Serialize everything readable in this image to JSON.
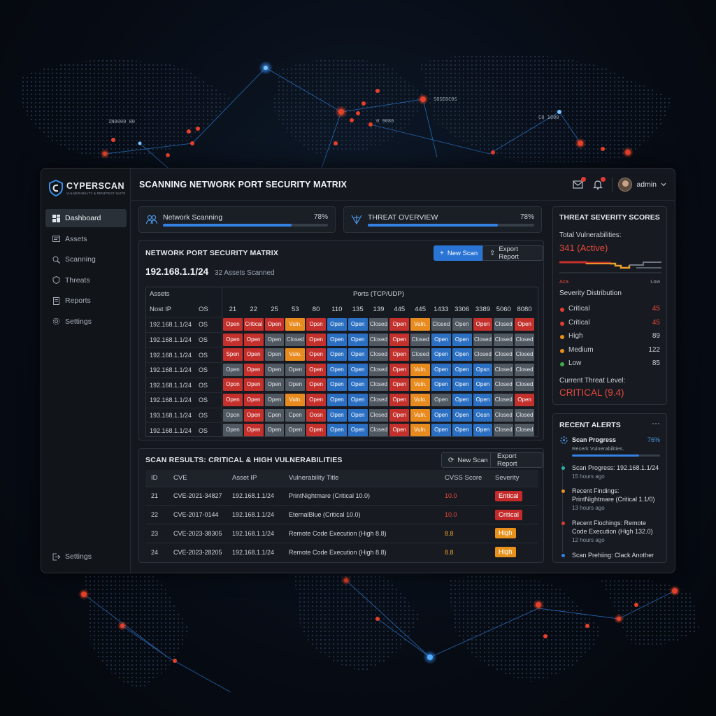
{
  "map": {
    "labels": [
      "IN0000 80",
      "SOSE0C0S",
      "0 9080",
      "C0 1000"
    ]
  },
  "brand": {
    "name": "CYPERSCAN",
    "tagline": "VULNERABILITY & PENETEST SUITE"
  },
  "header": {
    "title": "SCANNING NETWORK PORT SECURITY MATRIX",
    "user": "admin"
  },
  "sidebar": {
    "items": [
      {
        "label": "Dashboard",
        "icon": "dashboard-icon",
        "active": true
      },
      {
        "label": "Assets",
        "icon": "assets-icon",
        "active": false
      },
      {
        "label": "Scanning",
        "icon": "scanning-icon",
        "active": false
      },
      {
        "label": "Threats",
        "icon": "shield-icon",
        "active": false
      },
      {
        "label": "Reports",
        "icon": "reports-icon",
        "active": false
      },
      {
        "label": "Settings",
        "icon": "gear-icon",
        "active": false
      }
    ],
    "bottom": {
      "label": "Settings",
      "icon": "logout-icon"
    }
  },
  "progress": [
    {
      "label": "Network Scanning",
      "value_text": "78%",
      "value": 0.78
    },
    {
      "label": "THREAT OVERVIEW",
      "value_text": "78%",
      "value": 0.78
    }
  ],
  "matrix": {
    "title": "NETWORK PORT SECURITY MATRIX",
    "new_scan": "New Scan",
    "export": "Export Report",
    "subnet": "192.168.1.1/24",
    "asset_count": "32 Assets Scanned",
    "group_assets": "Assets",
    "group_ports": "Ports (TCP/UDP)",
    "col_ip": "Nost IP",
    "col_os": "OS",
    "ports": [
      "21",
      "22",
      "25",
      "53",
      "80",
      "110",
      "135",
      "139",
      "445",
      "445",
      "1433",
      "3306",
      "3389",
      "5060",
      "8080"
    ],
    "rows": [
      {
        "ip": "192.168.1.1/24",
        "os": "OS",
        "cells": [
          [
            "Open",
            "r"
          ],
          [
            "Critical",
            "r"
          ],
          [
            "Open",
            "r"
          ],
          [
            "Vuln.",
            "o"
          ],
          [
            "Opsn",
            "r"
          ],
          [
            "Open",
            "b"
          ],
          [
            "Open",
            "b"
          ],
          [
            "Closed",
            "g"
          ],
          [
            "Open",
            "r"
          ],
          [
            "Vuln.",
            "o"
          ],
          [
            "Closed",
            "g"
          ],
          [
            "Open",
            "g"
          ],
          [
            "Open",
            "r"
          ],
          [
            "Closed",
            "g"
          ],
          [
            "Open",
            "r"
          ]
        ]
      },
      {
        "ip": "192.168.1.1/24",
        "os": "OS",
        "cells": [
          [
            "Open",
            "r"
          ],
          [
            "Open",
            "r"
          ],
          [
            "Open",
            "g"
          ],
          [
            "Closed",
            "g"
          ],
          [
            "Open",
            "r"
          ],
          [
            "Open",
            "b"
          ],
          [
            "Open",
            "b"
          ],
          [
            "Closed",
            "g"
          ],
          [
            "Open",
            "r"
          ],
          [
            "Closed",
            "g"
          ],
          [
            "Open",
            "b"
          ],
          [
            "Open",
            "b"
          ],
          [
            "Closed",
            "g"
          ],
          [
            "Closed",
            "g"
          ],
          [
            "Closed",
            "g"
          ]
        ]
      },
      {
        "ip": "192.168.1.1/24",
        "os": "OS",
        "cells": [
          [
            "Spen",
            "r"
          ],
          [
            "Open",
            "r"
          ],
          [
            "Open",
            "g"
          ],
          [
            "Vulo.",
            "o"
          ],
          [
            "Open",
            "r"
          ],
          [
            "Open",
            "b"
          ],
          [
            "Open",
            "b"
          ],
          [
            "Closed",
            "g"
          ],
          [
            "Open",
            "r"
          ],
          [
            "Closed",
            "g"
          ],
          [
            "Open",
            "b"
          ],
          [
            "Open",
            "b"
          ],
          [
            "Closed",
            "g"
          ],
          [
            "Closed",
            "g"
          ],
          [
            "Closed",
            "g"
          ]
        ]
      },
      {
        "ip": "192.168.1.1/24",
        "os": "OS",
        "cells": [
          [
            "Open",
            "g"
          ],
          [
            "Open",
            "r"
          ],
          [
            "Open",
            "g"
          ],
          [
            "Open",
            "g"
          ],
          [
            "Open",
            "r"
          ],
          [
            "Open",
            "b"
          ],
          [
            "Open",
            "b"
          ],
          [
            "Closed",
            "g"
          ],
          [
            "Open",
            "r"
          ],
          [
            "Vuln.",
            "o"
          ],
          [
            "Open",
            "b"
          ],
          [
            "Open",
            "b"
          ],
          [
            "Opsn",
            "b"
          ],
          [
            "Closed",
            "g"
          ],
          [
            "Closed",
            "g"
          ]
        ]
      },
      {
        "ip": "192.168.1.1/24",
        "os": "OS",
        "cells": [
          [
            "Opon",
            "r"
          ],
          [
            "Open",
            "r"
          ],
          [
            "Open",
            "g"
          ],
          [
            "Open",
            "g"
          ],
          [
            "Open",
            "r"
          ],
          [
            "Open",
            "b"
          ],
          [
            "Open",
            "b"
          ],
          [
            "Closed",
            "g"
          ],
          [
            "Open",
            "r"
          ],
          [
            "Vuln.",
            "o"
          ],
          [
            "Open",
            "b"
          ],
          [
            "Open",
            "b"
          ],
          [
            "Open",
            "b"
          ],
          [
            "Closed",
            "g"
          ],
          [
            "Closed",
            "g"
          ]
        ]
      },
      {
        "ip": "192.168.1.1/24",
        "os": "OS",
        "cells": [
          [
            "Open",
            "r"
          ],
          [
            "Open",
            "r"
          ],
          [
            "Open",
            "g"
          ],
          [
            "Vuln.",
            "o"
          ],
          [
            "Open",
            "r"
          ],
          [
            "Open",
            "b"
          ],
          [
            "Open",
            "b"
          ],
          [
            "Closed",
            "g"
          ],
          [
            "Open",
            "r"
          ],
          [
            "Vulo.",
            "o"
          ],
          [
            "Open",
            "g"
          ],
          [
            "Open",
            "b"
          ],
          [
            "Open",
            "b"
          ],
          [
            "Closed",
            "g"
          ],
          [
            "Open",
            "r"
          ]
        ]
      },
      {
        "ip": "193.168.1.1/24",
        "os": "OS",
        "cells": [
          [
            "Opon",
            "g"
          ],
          [
            "Open",
            "r"
          ],
          [
            "Cpen",
            "g"
          ],
          [
            "Cpen",
            "g"
          ],
          [
            "Oosn",
            "r"
          ],
          [
            "Open",
            "b"
          ],
          [
            "Open",
            "b"
          ],
          [
            "Clesed",
            "g"
          ],
          [
            "Open",
            "r"
          ],
          [
            "Vuln.",
            "o"
          ],
          [
            "Open",
            "b"
          ],
          [
            "Open",
            "b"
          ],
          [
            "Oosn",
            "b"
          ],
          [
            "Closed",
            "g"
          ],
          [
            "Closed",
            "g"
          ]
        ]
      },
      {
        "ip": "192.168.1.1/24",
        "os": "OS",
        "cells": [
          [
            "Open",
            "g"
          ],
          [
            "Open",
            "r"
          ],
          [
            "Open",
            "g"
          ],
          [
            "Open",
            "g"
          ],
          [
            "Open",
            "r"
          ],
          [
            "Open",
            "b"
          ],
          [
            "Open",
            "b"
          ],
          [
            "Closed",
            "g"
          ],
          [
            "Open",
            "r"
          ],
          [
            "Vuln.",
            "o"
          ],
          [
            "Open",
            "b"
          ],
          [
            "Open",
            "b"
          ],
          [
            "Open",
            "b"
          ],
          [
            "Closed",
            "g"
          ],
          [
            "Closed",
            "g"
          ]
        ]
      }
    ]
  },
  "results": {
    "title": "SCAN RESULTS: CRITICAL & HIGH VULNERABILITIES",
    "new_scan": "New Scan",
    "export": "Export Report",
    "columns": [
      "ID",
      "CVE",
      "Asset IP",
      "Vulnerability Title",
      "CVSS Score",
      "Severity"
    ],
    "rows": [
      {
        "id": "21",
        "cve": "CVE-2021-34827",
        "ip": "192.168.1.1/24",
        "title": "PrintNightmare (Critical 10.0)",
        "score": "10.0",
        "severity": "Entical",
        "level": "critical"
      },
      {
        "id": "22",
        "cve": "CVE-2017-0144",
        "ip": "192.168.1.1/24",
        "title": "EternalBlue (Critical 10.0)",
        "score": "10.0",
        "severity": "Critical",
        "level": "critical"
      },
      {
        "id": "23",
        "cve": "CVE-2023-38305",
        "ip": "192.168.1.1/24",
        "title": "Remote Code Execution (High 8.8)",
        "score": "8.8",
        "severity": "High",
        "level": "high"
      },
      {
        "id": "24",
        "cve": "CVE-2023-28205",
        "ip": "192.168.1.1/24",
        "title": "Remote Code Execution (High 8.8)",
        "score": "8.8",
        "severity": "High",
        "level": "high"
      }
    ]
  },
  "severity": {
    "title": "THREAT SEVERITY SCORES",
    "total_label": "Total Vulnerabilities:",
    "total_value": "341 (Active)",
    "axis_left": "Aca",
    "axis_right": "Low",
    "dist_title": "Severity Distribution",
    "distribution": [
      {
        "label": "Critical",
        "value": "45",
        "color": "#e23b30"
      },
      {
        "label": "Critical",
        "value": "45",
        "color": "#e23b30"
      },
      {
        "label": "High",
        "value": "89",
        "color": "#e8901c"
      },
      {
        "label": "Medium",
        "value": "122",
        "color": "#e8901c"
      },
      {
        "label": "Low",
        "value": "85",
        "color": "#3fae4a"
      }
    ],
    "level_label": "Current Threat Level:",
    "level_value": "CRITICAL (9.4)"
  },
  "alerts": {
    "title": "RECENT ALERTS",
    "more": "···",
    "progress_title": "Scan Progress",
    "progress_sub": "Recerk Vulnerabilities.",
    "progress_value_text": "76%",
    "progress_value": 0.76,
    "items": [
      {
        "text": "Scan Progress: 192.168.1.1/24",
        "time": "15 hours ago",
        "color": "#2bb3a8"
      },
      {
        "text": "Recent Findings: PrintNightmare (Critical 1.1/0)",
        "time": "13 hours ago",
        "color": "#e8901c"
      },
      {
        "text": "Recent Flochings: Remote Code Execution (High 132.0)",
        "time": "12 hours ago",
        "color": "#e23b30"
      },
      {
        "text": "Scan Prehiing: Clack Another",
        "time": "",
        "color": "#3481e3"
      }
    ]
  }
}
